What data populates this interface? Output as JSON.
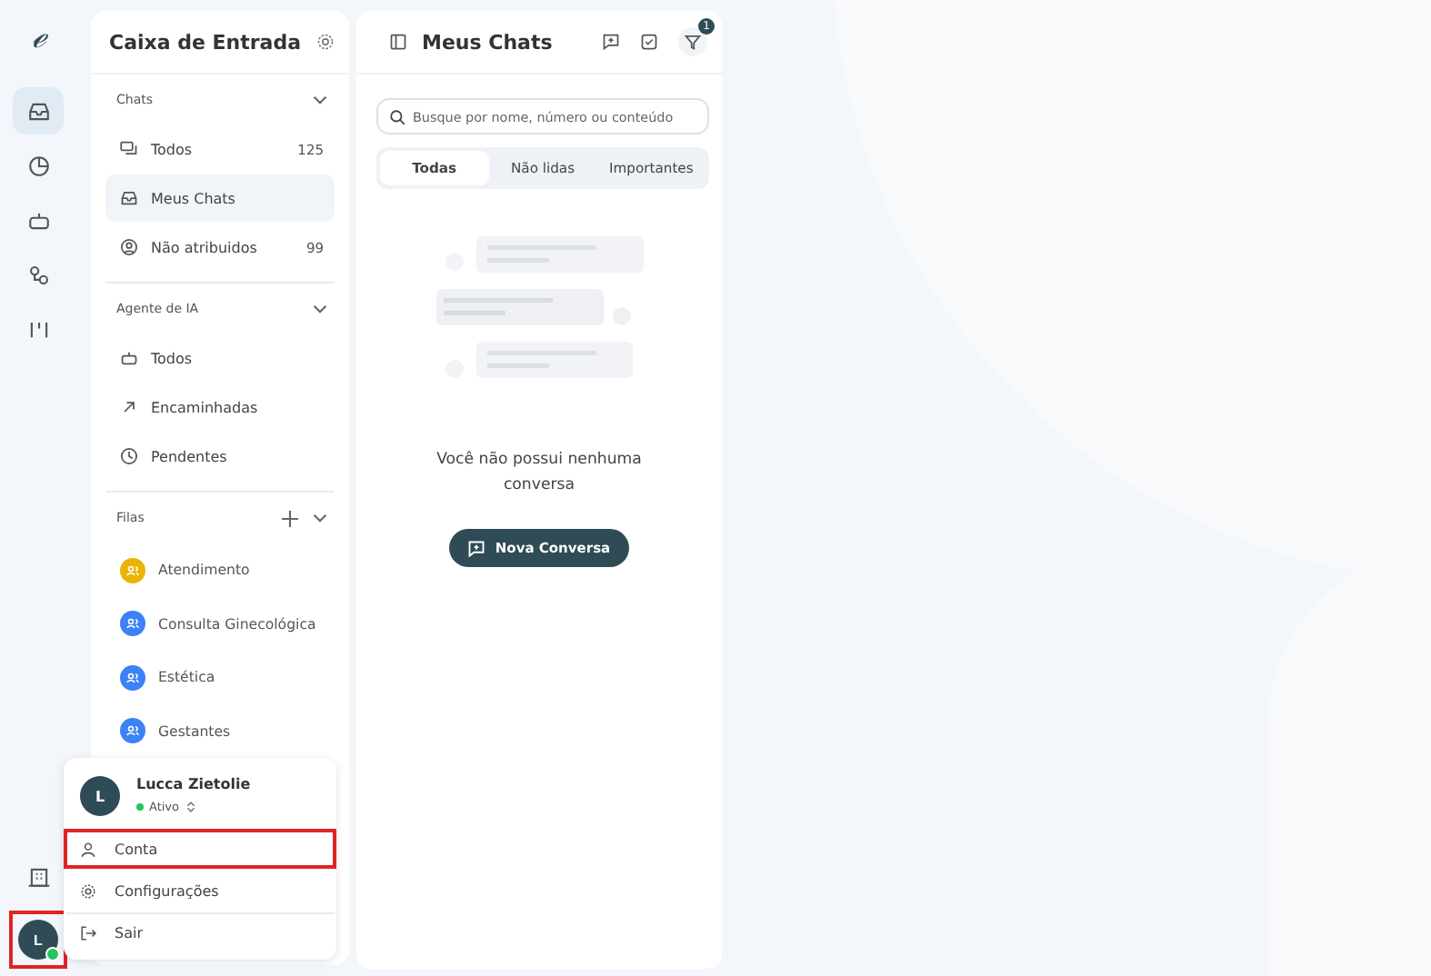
{
  "rail": {
    "logo": "ℯ",
    "items": [
      {
        "kind": "inbox",
        "selected": true
      },
      {
        "kind": "chart",
        "selected": false
      },
      {
        "kind": "bot",
        "selected": false
      },
      {
        "kind": "flow",
        "selected": false
      },
      {
        "kind": "kanban",
        "selected": false
      }
    ],
    "avatar": {
      "initial": "L",
      "online": true,
      "highlighted": true
    }
  },
  "sidebar": {
    "title": "Caixa de Entrada",
    "sections": [
      {
        "label": "Chats",
        "addable": false,
        "items": [
          {
            "kind": "chats",
            "label": "Todos",
            "count": "125",
            "selected": false
          },
          {
            "kind": "inbox",
            "label": "Meus Chats",
            "selected": true
          },
          {
            "kind": "user",
            "label": "Não atribuidos",
            "count": "99",
            "selected": false
          }
        ]
      },
      {
        "label": "Agente de IA",
        "addable": false,
        "items": [
          {
            "kind": "bot",
            "label": "Todos",
            "selected": false
          },
          {
            "kind": "arrow",
            "label": "Encaminhadas",
            "selected": false
          },
          {
            "kind": "clock",
            "label": "Pendentes",
            "selected": false
          }
        ]
      },
      {
        "label": "Filas",
        "addable": true,
        "queues": [
          {
            "label": "Atendimento",
            "color": "#eab308"
          },
          {
            "label": "Consulta Ginecológica",
            "color": "#3b82f6"
          },
          {
            "label": "Estética",
            "color": "#3b82f6"
          },
          {
            "label": "Gestantes",
            "color": "#3b82f6"
          }
        ]
      }
    ]
  },
  "chats": {
    "title": "Meus Chats",
    "filter_badge": "1",
    "search": {
      "placeholder": "Busque por nome, número ou conteúdo"
    },
    "tabs": [
      {
        "label": "Todas",
        "selected": true
      },
      {
        "label": "Não lidas",
        "selected": false
      },
      {
        "label": "Importantes",
        "selected": false
      }
    ],
    "empty_message": "Você não possui nenhuma conversa",
    "new_button": "Nova Conversa"
  },
  "user_menu": {
    "name": "Lucca Zietolie",
    "initial": "L",
    "status": "Ativo",
    "online": true,
    "items": [
      {
        "kind": "account",
        "label": "Conta",
        "highlighted": true
      },
      {
        "kind": "settings",
        "label": "Configurações",
        "highlighted": false
      },
      {
        "kind": "logout",
        "label": "Sair",
        "highlighted": false
      }
    ]
  }
}
